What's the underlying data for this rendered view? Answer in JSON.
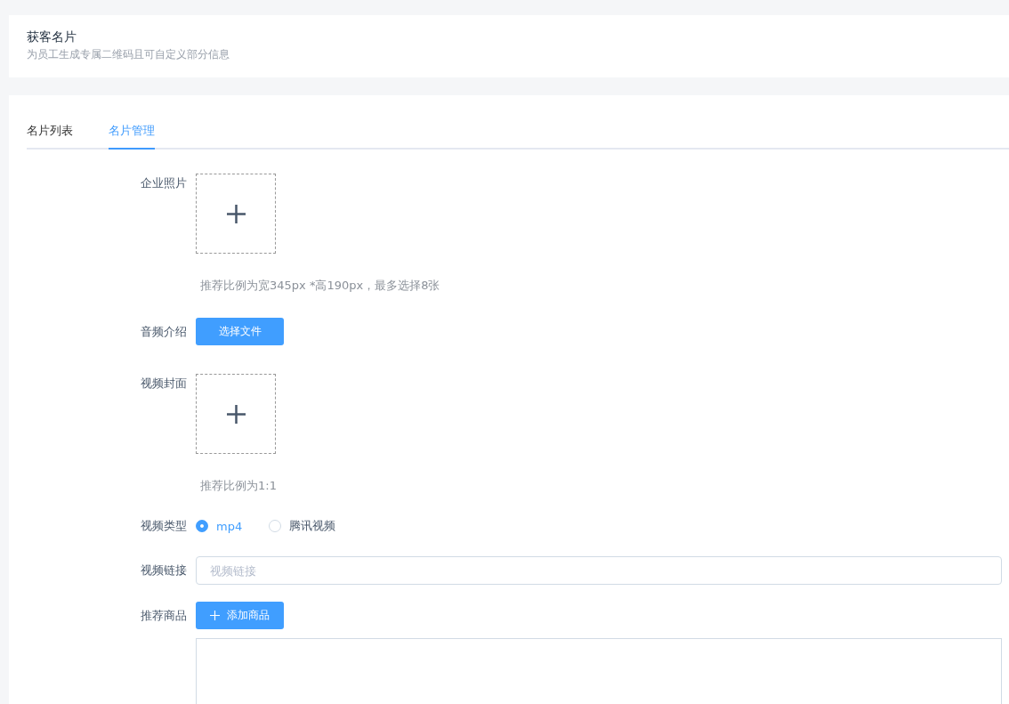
{
  "header": {
    "title": "获客名片",
    "subtitle": "为员工生成专属二维码且可自定义部分信息"
  },
  "tabs": [
    {
      "label": "名片列表",
      "selected": false
    },
    {
      "label": "名片管理",
      "selected": true
    }
  ],
  "form": [
    {
      "kind": "upload",
      "label": "企业照片",
      "hint": "推荐比例为宽345px *高190px，最多选择8张"
    },
    {
      "kind": "button",
      "label": "音频介绍",
      "button": "选择文件"
    },
    {
      "kind": "upload",
      "label": "视频封面",
      "hint": "推荐比例为1:1"
    },
    {
      "kind": "radio",
      "label": "视频类型",
      "options": [
        {
          "label": "mp4",
          "selected": true
        },
        {
          "label": "腾讯视频",
          "selected": false
        }
      ]
    },
    {
      "kind": "input",
      "label": "视频链接",
      "placeholder": "视频链接"
    },
    {
      "kind": "button-list",
      "label": "推荐商品",
      "button": "添加商品"
    }
  ]
}
